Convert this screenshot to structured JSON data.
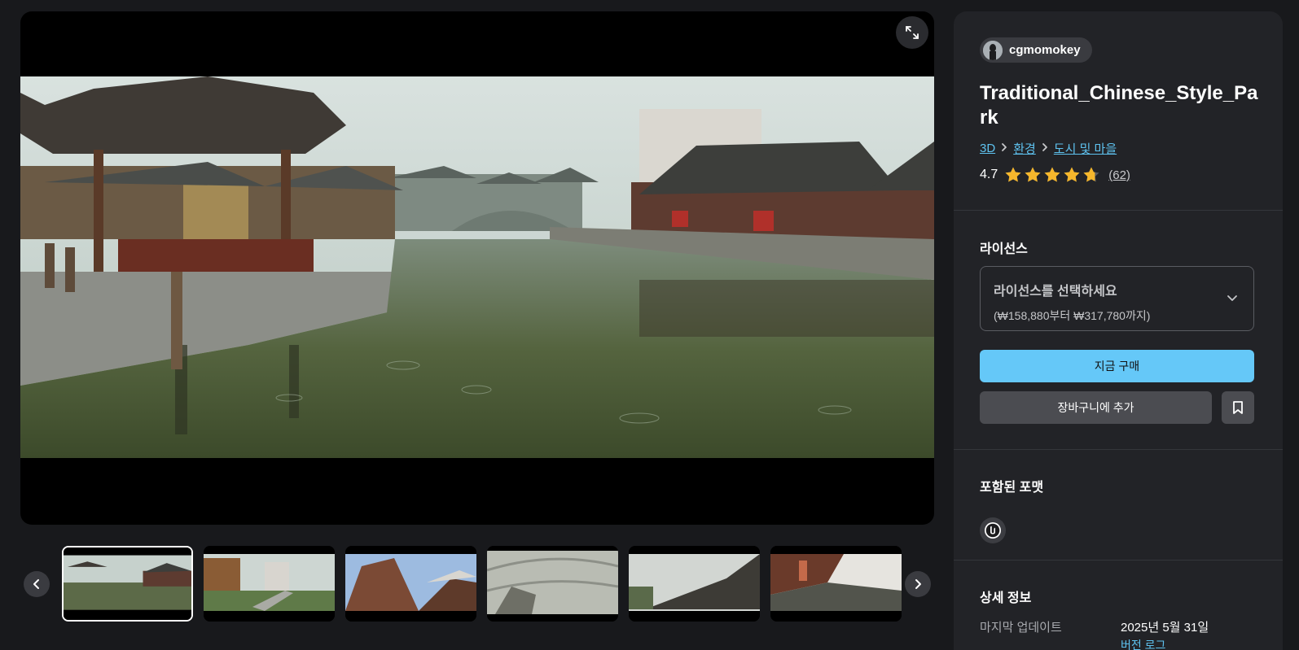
{
  "viewer": {
    "fullscreen_icon": "expand-icon",
    "prev_icon": "chevron-left-icon",
    "next_icon": "chevron-right-icon",
    "thumbnail_count": 6,
    "selected_thumbnail": 1
  },
  "product": {
    "author": "cgmomokey",
    "title": "Traditional_Chinese_Style_Park",
    "breadcrumb": [
      "3D",
      "환경",
      "도시 및 마을"
    ],
    "rating": "4.7",
    "rating_stars": 4.7,
    "review_count": "(62)"
  },
  "license": {
    "heading": "라이선스",
    "select_label": "라이선스를 선택하세요",
    "price_range": "(₩158,880부터 ₩317,780까지)",
    "buy_label": "지금 구매",
    "cart_label": "장바구니에 추가"
  },
  "formats": {
    "heading": "포함된 포맷",
    "icons": [
      "unreal-engine-icon"
    ]
  },
  "details": {
    "heading": "상세 정보",
    "last_updated_label": "마지막 업데이트",
    "last_updated_value": "2025년 5월 31일",
    "sub_link": "버전 로그"
  },
  "colors": {
    "accent": "#65c8f8",
    "link": "#5ec2ef",
    "star": "#f6b72c",
    "panel_bg": "#222327",
    "page_bg": "#18191c"
  }
}
